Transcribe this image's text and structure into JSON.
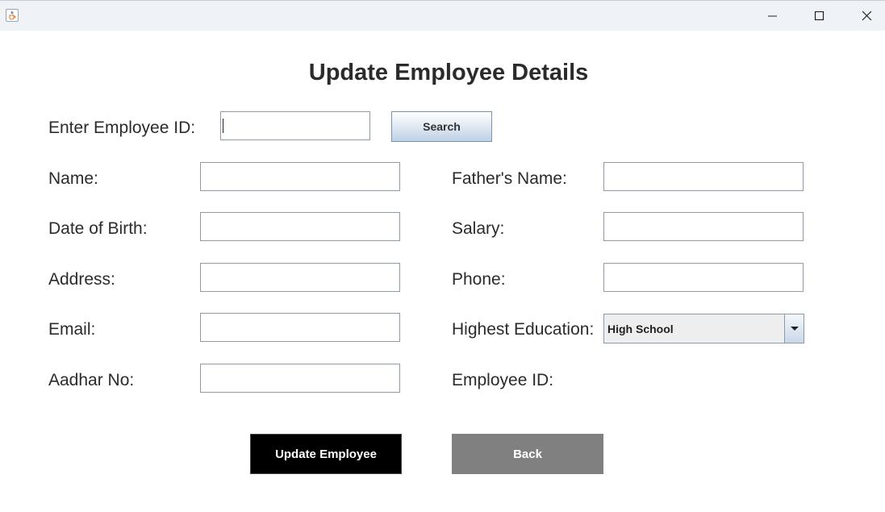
{
  "window": {
    "app_icon": "java-cup-icon",
    "controls": [
      "minimize-icon",
      "maximize-icon",
      "close-icon"
    ]
  },
  "page": {
    "title": "Update Employee Details"
  },
  "search": {
    "label": "Enter Employee ID:",
    "value": "",
    "button_label": "Search"
  },
  "form": {
    "name": {
      "label": "Name:",
      "value": ""
    },
    "date_of_birth": {
      "label": "Date of Birth:",
      "value": ""
    },
    "address": {
      "label": "Address:",
      "value": ""
    },
    "email": {
      "label": "Email:",
      "value": ""
    },
    "aadhar_no": {
      "label": "Aadhar No:",
      "value": ""
    },
    "fathers_name": {
      "label": "Father's Name:",
      "value": ""
    },
    "salary": {
      "label": "Salary:",
      "value": ""
    },
    "phone": {
      "label": "Phone:",
      "value": ""
    },
    "highest_education": {
      "label": "Highest Education:",
      "selected": "High School"
    },
    "employee_id": {
      "label": "Employee ID:",
      "value": ""
    }
  },
  "actions": {
    "update_label": "Update Employee",
    "back_label": "Back"
  },
  "colors": {
    "update_button": "#000000",
    "back_button": "#808080",
    "titlebar": "#eff3f8"
  }
}
